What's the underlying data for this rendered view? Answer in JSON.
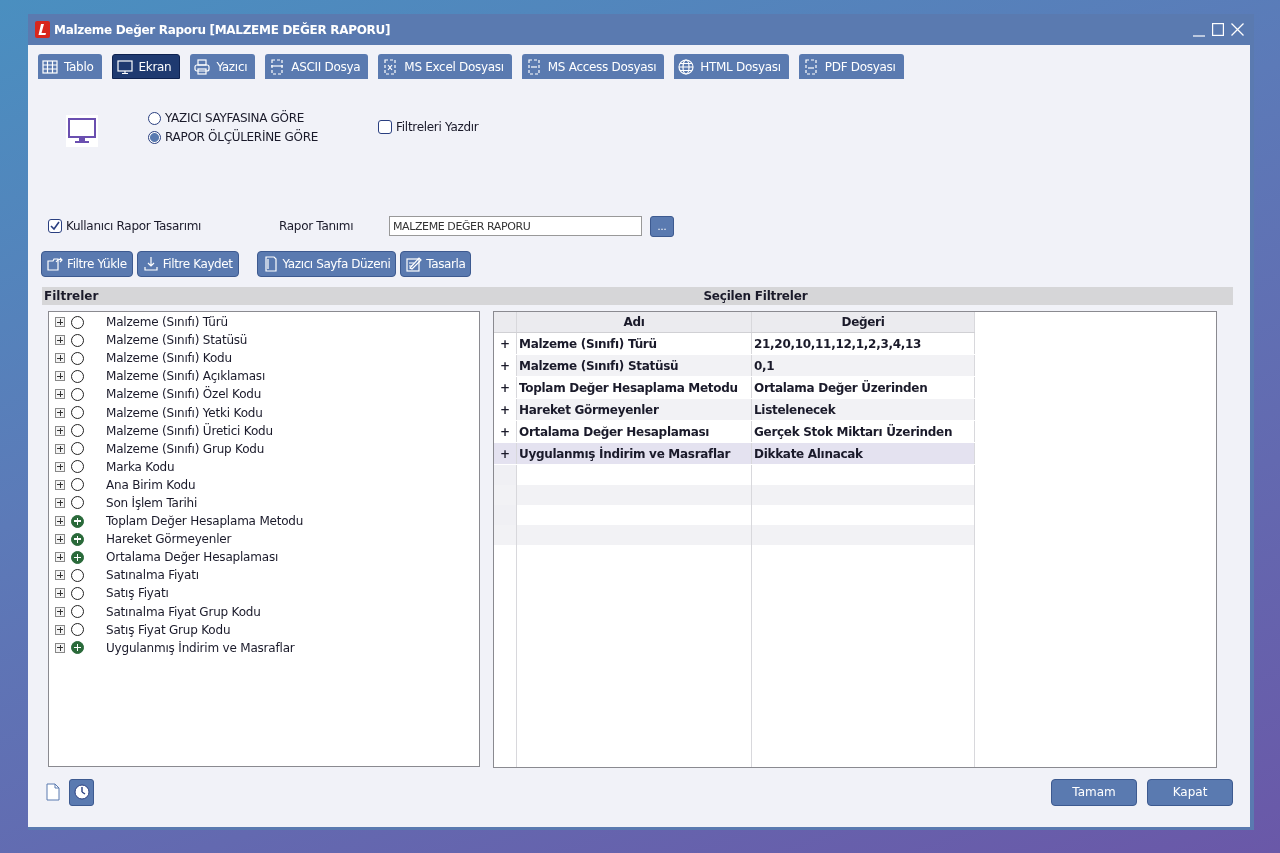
{
  "window": {
    "title": "Malzeme Değer Raporu [MALZEME DEĞER RAPORU]"
  },
  "output_tabs": [
    {
      "label": "Tablo",
      "kind": "table",
      "selected": false
    },
    {
      "label": "Ekran",
      "kind": "monitor",
      "selected": true
    },
    {
      "label": "Yazıcı",
      "kind": "printer",
      "selected": false
    },
    {
      "label": "ASCII Dosya",
      "kind": "ascii",
      "selected": false
    },
    {
      "label": "MS Excel Dosyası",
      "kind": "excel",
      "selected": false
    },
    {
      "label": "MS Access Dosyası",
      "kind": "access",
      "selected": false
    },
    {
      "label": "HTML Dosyası",
      "kind": "html",
      "selected": false
    },
    {
      "label": "PDF Dosyası",
      "kind": "pdf",
      "selected": false
    }
  ],
  "screen_options": {
    "radios": [
      {
        "label": "YAZICI SAYFASINA GÖRE",
        "selected": false
      },
      {
        "label": "RAPOR ÖLÇÜLERİNE GÖRE",
        "selected": true
      }
    ],
    "print_filters": {
      "label": "Filtreleri Yazdır",
      "checked": false
    }
  },
  "user_design": {
    "label": "Kullanıcı Rapor Tasarımı",
    "checked": true
  },
  "report_definition": {
    "label": "Rapor Tanımı",
    "value": "MALZEME DEĞER RAPORU",
    "browse": "..."
  },
  "action_buttons": [
    {
      "label": "Filtre Yükle",
      "kind": "load"
    },
    {
      "label": "Filtre Kaydet",
      "kind": "save"
    },
    {
      "label": "Yazıcı Sayfa Düzeni",
      "kind": "page"
    },
    {
      "label": "Tasarla",
      "kind": "design"
    }
  ],
  "filters": {
    "title": "Filtreler",
    "items": [
      {
        "label": "Malzeme (Sınıfı) Türü",
        "active": false
      },
      {
        "label": "Malzeme (Sınıfı) Statüsü",
        "active": false
      },
      {
        "label": "Malzeme (Sınıfı) Kodu",
        "active": false
      },
      {
        "label": "Malzeme (Sınıfı) Açıklaması",
        "active": false
      },
      {
        "label": "Malzeme (Sınıfı) Özel Kodu",
        "active": false
      },
      {
        "label": "Malzeme (Sınıfı) Yetki Kodu",
        "active": false
      },
      {
        "label": "Malzeme (Sınıfı) Üretici Kodu",
        "active": false
      },
      {
        "label": "Malzeme (Sınıfı) Grup Kodu",
        "active": false
      },
      {
        "label": "Marka Kodu",
        "active": false
      },
      {
        "label": "Ana Birim Kodu",
        "active": false
      },
      {
        "label": "Son İşlem Tarihi",
        "active": false
      },
      {
        "label": "Toplam Değer Hesaplama Metodu",
        "active": true
      },
      {
        "label": "Hareket Görmeyenler",
        "active": true
      },
      {
        "label": "Ortalama Değer Hesaplaması",
        "active": true
      },
      {
        "label": "Satınalma Fiyatı",
        "active": false
      },
      {
        "label": "Satış Fiyatı",
        "active": false
      },
      {
        "label": "Satınalma Fiyat Grup Kodu",
        "active": false
      },
      {
        "label": "Satış Fiyat Grup Kodu",
        "active": false
      },
      {
        "label": "Uygulanmış İndirim ve Masraflar",
        "active": true
      }
    ]
  },
  "selected_filters": {
    "title": "Seçilen Filtreler",
    "columns": [
      "Adı",
      "Değeri"
    ],
    "rows": [
      {
        "marker": "+",
        "name": "Malzeme (Sınıfı) Türü",
        "value": "21,20,10,11,12,1,2,3,4,13",
        "selected": false
      },
      {
        "marker": "+",
        "name": "Malzeme (Sınıfı) Statüsü",
        "value": "0,1",
        "selected": false
      },
      {
        "marker": "+",
        "name": "Toplam Değer Hesaplama Metodu",
        "value": "Ortalama Değer Üzerinden",
        "selected": false
      },
      {
        "marker": "+",
        "name": "Hareket Görmeyenler",
        "value": "Listelenecek",
        "selected": false
      },
      {
        "marker": "+",
        "name": "Ortalama Değer Hesaplaması",
        "value": "Gerçek Stok Miktarı Üzerinden",
        "selected": false
      },
      {
        "marker": "+",
        "name": "Uygulanmış İndirim ve Masraflar",
        "value": "Dikkate Alınacak",
        "selected": true
      }
    ]
  },
  "footer_buttons": [
    "Tamam",
    "Kapat"
  ]
}
